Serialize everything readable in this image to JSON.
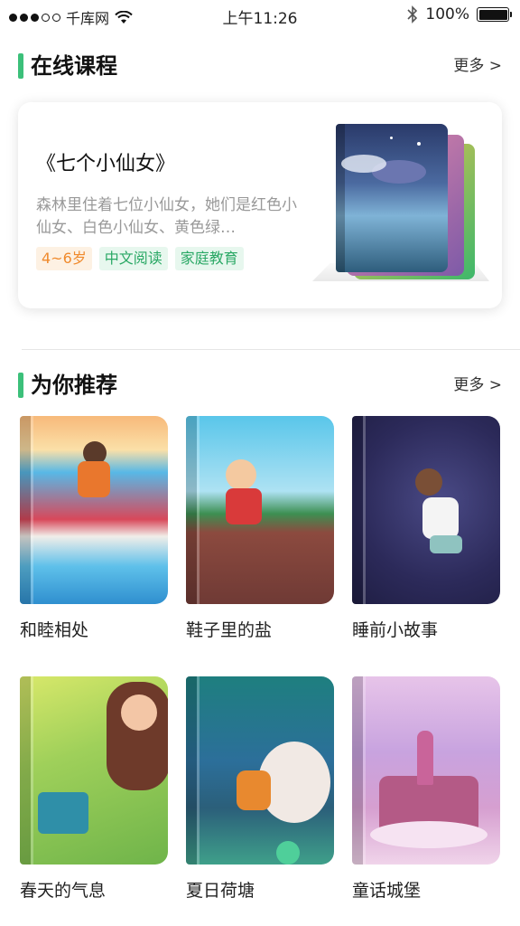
{
  "status_bar": {
    "carrier": "千库网",
    "time": "上午11:26",
    "battery": "100%",
    "battery_level": 1.0,
    "icons": [
      "signal-dots-icon",
      "wifi-icon",
      "bluetooth-icon",
      "battery-icon"
    ]
  },
  "online_courses": {
    "title": "在线课程",
    "more": "更多 >",
    "featured": {
      "title": "《七个小仙女》",
      "description": "森林里住着七位小仙女，她们是红色小仙女、白色小仙女、黄色绿…",
      "tags": [
        "4~6岁",
        "中文阅读",
        "家庭教育"
      ]
    }
  },
  "recommendations": {
    "title": "为你推荐",
    "more": "更多 >",
    "items": [
      {
        "label": "和睦相处"
      },
      {
        "label": "鞋子里的盐"
      },
      {
        "label": "睡前小故事"
      },
      {
        "label": "春天的气息"
      },
      {
        "label": "夏日荷塘"
      },
      {
        "label": "童话城堡"
      }
    ]
  },
  "colors": {
    "accent_green": "#3cc07a",
    "tag_orange": "#f08a2c",
    "tag_green": "#2aa865"
  }
}
